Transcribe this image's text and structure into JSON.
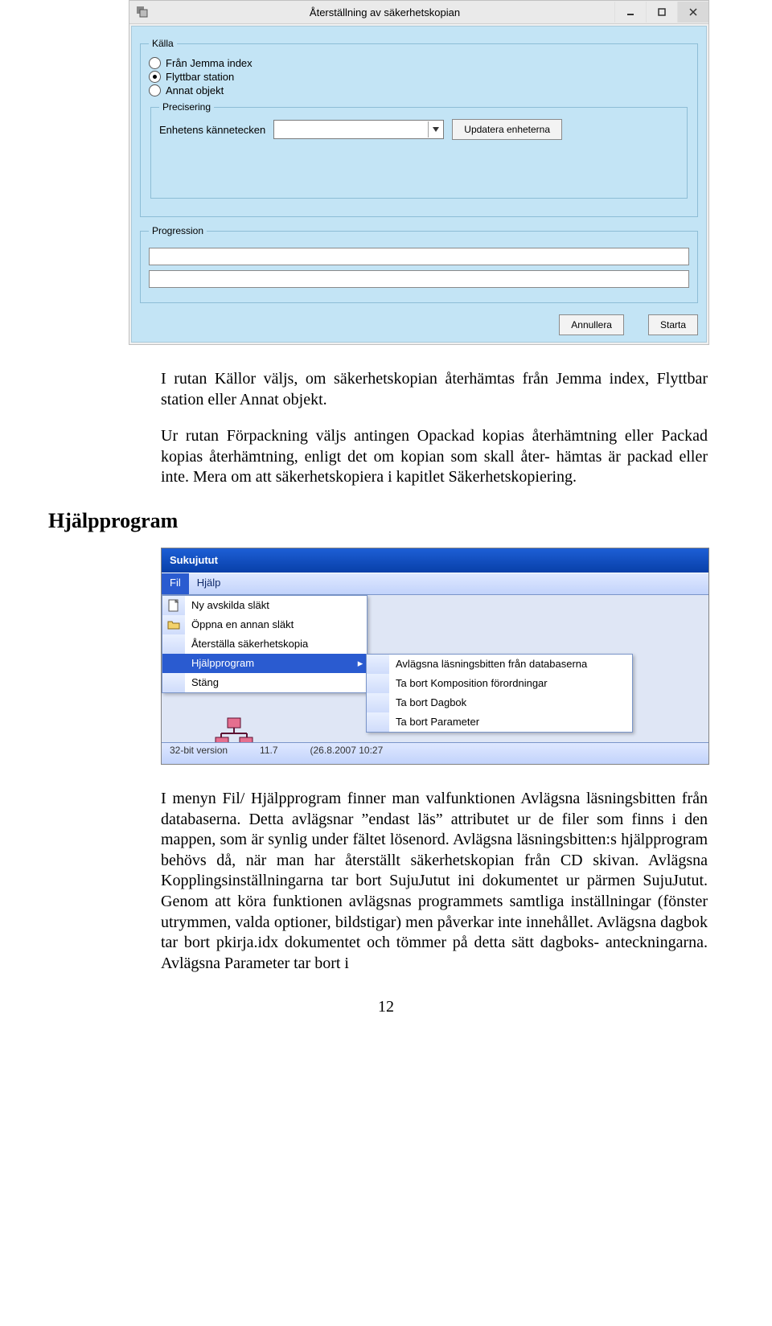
{
  "dialog1": {
    "title": "Återställning av säkerhetskopian",
    "groups": {
      "kalla": {
        "legend": "Källa",
        "options": [
          "Från Jemma index",
          "Flyttbar station",
          "Annat objekt"
        ],
        "selected": 1
      },
      "precisering": {
        "legend": "Precisering",
        "label": "Enhetens kännetecken",
        "update_btn": "Updatera enheterna"
      },
      "progression": {
        "legend": "Progression"
      }
    },
    "buttons": {
      "cancel": "Annullera",
      "start": "Starta"
    }
  },
  "para1": "I rutan Källor väljs, om säkerhetskopian återhämtas från Jemma index, Flyttbar station eller Annat objekt.",
  "para2": "Ur rutan Förpackning väljs antingen Opackad kopias återhämtning eller Packad kopias återhämtning, enligt det om kopian som skall åter- hämtas är packad eller inte. Mera om att säkerhetskopiera i kapitlet Säkerhetskopiering.",
  "section_heading": "Hjälpprogram",
  "dialog2": {
    "title": "Sukujutut",
    "menubar": [
      "Fil",
      "Hjälp"
    ],
    "open_menu_index": 0,
    "dropdown": [
      {
        "label": "Ny avskilda släkt",
        "icon": "new-doc"
      },
      {
        "label": "Öppna en annan släkt",
        "icon": "open-folder"
      },
      {
        "label": "Återställa säkerhetskopia",
        "icon": null
      },
      {
        "label": "Hjälpprogram",
        "icon": null,
        "submenu": true,
        "hover": true
      },
      {
        "label": "Stäng",
        "icon": null
      }
    ],
    "submenu": [
      "Avlägsna läsningsbitten från databaserna",
      "Ta bort Komposition förordningar",
      "Ta bort Dagbok",
      "Ta bort Parameter"
    ],
    "statusbar": [
      "32-bit version",
      "11.7",
      "(26.8.2007 10:27"
    ]
  },
  "para3": "I menyn Fil/ Hjälpprogram finner man valfunktionen Avlägsna läsningsbitten från databaserna. Detta avlägsnar ”endast läs” attributet ur de filer som finns i den mappen, som är synlig under fältet lösenord. Avlägsna läsningsbitten:s hjälpprogram behövs då, när man har återställt säkerhetskopian från CD skivan. Avlägsna Kopplingsinställningarna tar bort SujuJutut ini dokumentet ur pärmen SujuJutut. Genom att köra funktionen avlägsnas programmets samtliga inställningar (fönster utrymmen, valda optioner, bildstigar) men påverkar inte innehållet. Avlägsna dagbok tar bort pkirja.idx dokumentet och tömmer på detta sätt dagboks- anteckningarna. Avlägsna Parameter tar bort i",
  "page_number": "12"
}
